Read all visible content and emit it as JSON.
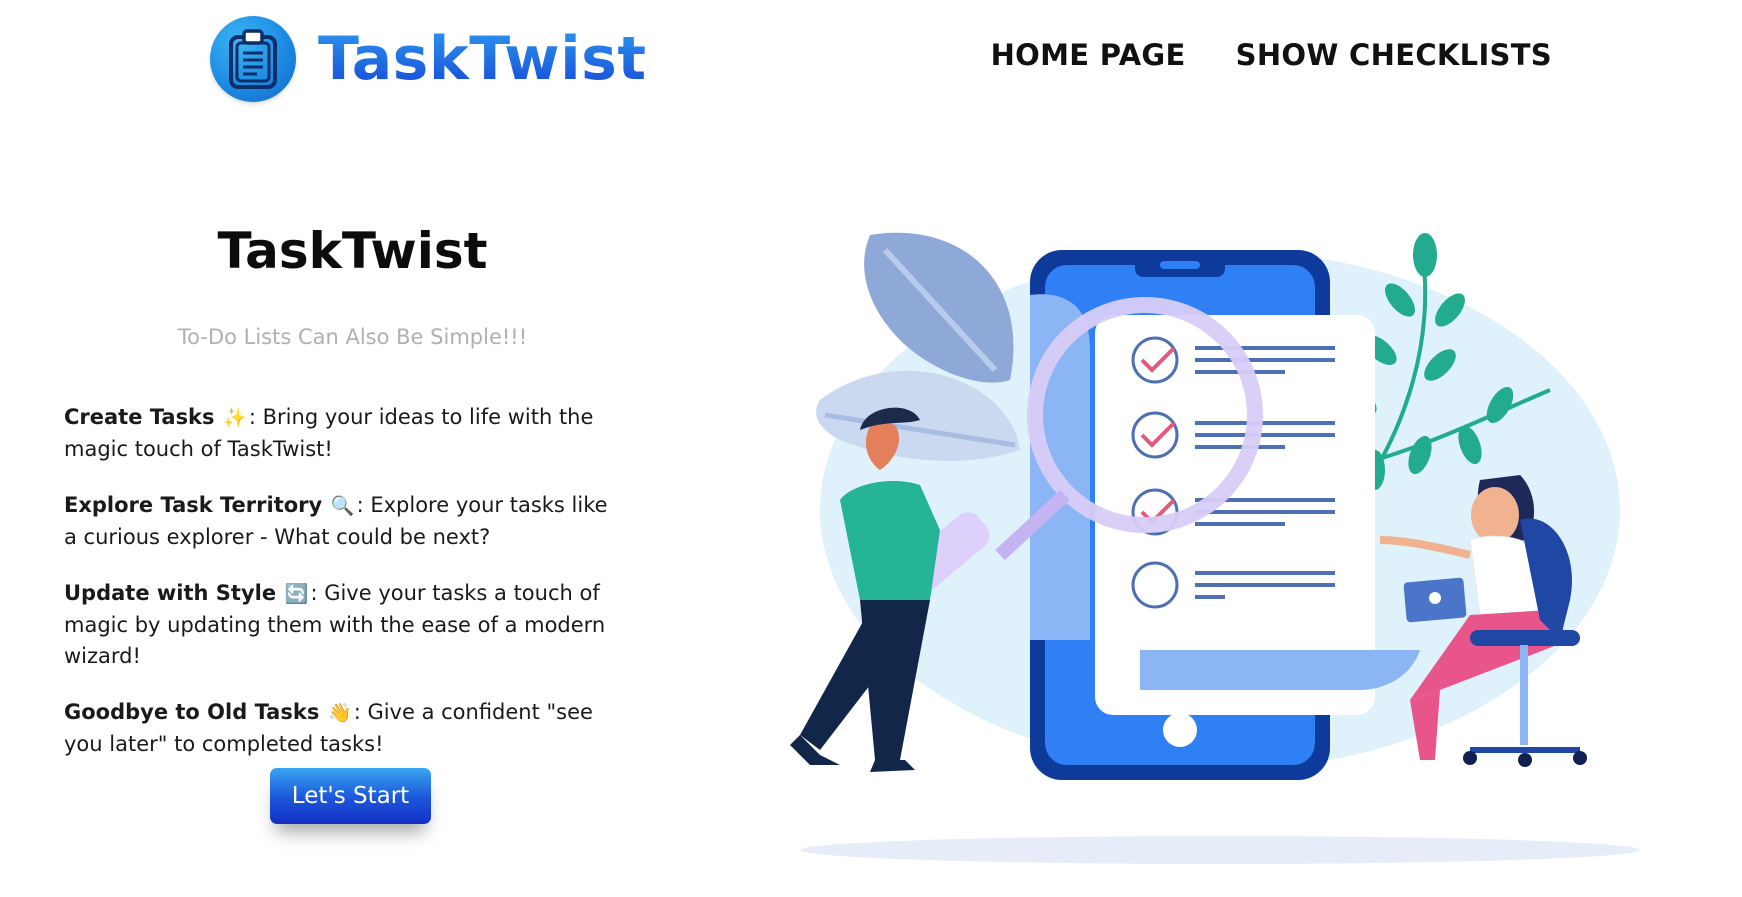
{
  "header": {
    "logo_text": "TaskTwist",
    "nav": [
      {
        "label": "HOME PAGE"
      },
      {
        "label": "SHOW CHECKLISTS"
      }
    ]
  },
  "hero": {
    "title": "TaskTwist",
    "tagline": "To-Do Lists Can Also Be Simple!!!",
    "features": [
      {
        "title": "Create Tasks",
        "emoji": "✨",
        "text": ": Bring your ideas to life with the magic touch of TaskTwist!"
      },
      {
        "title": "Explore Task Territory",
        "emoji": "🔍",
        "text": ": Explore your tasks like a curious explorer - What could be next?"
      },
      {
        "title": "Update with Style",
        "emoji": "🔄",
        "text": ": Give your tasks a touch of magic by updating them with the ease of a modern wizard!"
      },
      {
        "title": "Goodbye to Old Tasks",
        "emoji": "👋",
        "text": ": Give a confident \"see you later\" to completed tasks!"
      }
    ],
    "cta_label": "Let's Start"
  },
  "colors": {
    "brand_blue": "#1a6ee6",
    "cta_blue": "#1b55d9",
    "phone_blue": "#2a6ff0",
    "plant_green": "#21a98c"
  },
  "illustration": {
    "icons": [
      "clipboard-icon",
      "magnifier-icon",
      "checklist",
      "phone",
      "laptop"
    ]
  }
}
